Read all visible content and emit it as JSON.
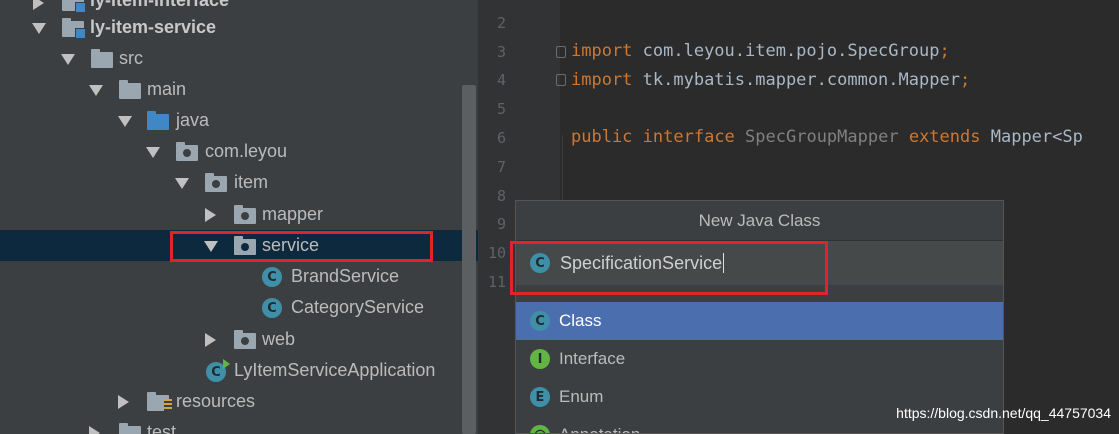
{
  "tree": {
    "items": [
      {
        "label": "ly-item-interface"
      },
      {
        "label": "ly-item-service"
      },
      {
        "label": "src"
      },
      {
        "label": "main"
      },
      {
        "label": "java"
      },
      {
        "label": "com.leyou"
      },
      {
        "label": "item"
      },
      {
        "label": "mapper"
      },
      {
        "label": "service"
      },
      {
        "label": "BrandService"
      },
      {
        "label": "CategoryService"
      },
      {
        "label": "web"
      },
      {
        "label": "LyItemServiceApplication"
      },
      {
        "label": "resources"
      },
      {
        "label": "test"
      }
    ]
  },
  "editor": {
    "line_numbers": [
      "2",
      "3",
      "4",
      "5",
      "6",
      "7",
      "8",
      "9",
      "10",
      "11"
    ],
    "line3": {
      "kw": "import",
      "rest": " com.leyou.item.pojo.SpecGroup",
      "semi": ";"
    },
    "line4": {
      "kw": "import",
      "rest": " tk.mybatis.mapper.common.Mapper",
      "semi": ";"
    },
    "line6": {
      "kw1": "public",
      "kw2": "interface",
      "name": "SpecGroupMapper",
      "kw3": "extends",
      "rest": "Mapper<Sp"
    }
  },
  "dialog": {
    "title": "New Java Class",
    "name_value": "SpecificationService",
    "options": [
      {
        "label": "Class",
        "icon": "C"
      },
      {
        "label": "Interface",
        "icon": "I"
      },
      {
        "label": "Enum",
        "icon": "E"
      },
      {
        "label": "Annotation",
        "icon": "@"
      }
    ],
    "selected": "Class"
  },
  "colors": {
    "highlight": "#e0242a",
    "selection": "#4b6eaf"
  },
  "watermark": "https://blog.csdn.net/qq_44757034"
}
